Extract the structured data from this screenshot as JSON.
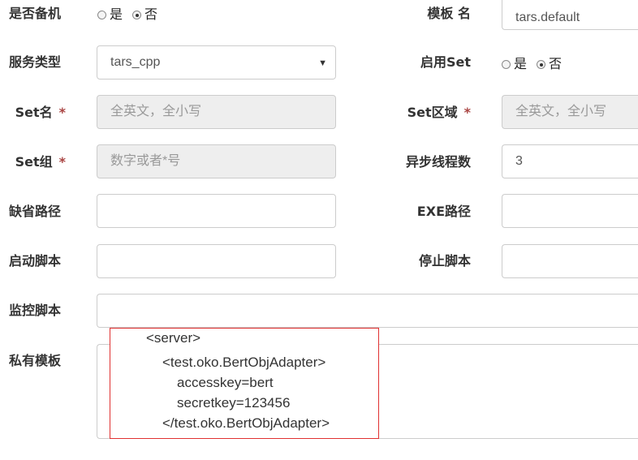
{
  "backup": {
    "label": "是否备机",
    "options": [
      "是",
      "否"
    ],
    "selected": "否"
  },
  "template_name": {
    "label": "模板 名",
    "value": "tars.default"
  },
  "service_type": {
    "label": "服务类型",
    "value": "tars_cpp"
  },
  "enable_set": {
    "label": "启用Set",
    "options": [
      "是",
      "否"
    ],
    "selected": "否"
  },
  "set_name": {
    "label": "Set名",
    "required_mark": "*",
    "placeholder": "全英文，全小写"
  },
  "set_area": {
    "label": "Set区域",
    "required_mark": "*",
    "placeholder": "全英文，全小写"
  },
  "set_group": {
    "label": "Set组",
    "required_mark": "*",
    "placeholder": "数字或者*号"
  },
  "async_threads": {
    "label": "异步线程数",
    "value": "3"
  },
  "default_path": {
    "label": "缺省路径",
    "value": ""
  },
  "exe_path": {
    "label": "EXE路径",
    "value": ""
  },
  "start_script": {
    "label": "启动脚本",
    "value": ""
  },
  "stop_script": {
    "label": "停止脚本",
    "value": ""
  },
  "monitor_script": {
    "label": "监控脚本",
    "value": ""
  },
  "private_template": {
    "label": "私有模板",
    "lines": [
      "<server>",
      "<test.oko.BertObjAdapter>",
      "accesskey=bert",
      "secretkey=123456",
      "</test.oko.BertObjAdapter>"
    ]
  },
  "colors": {
    "required": "#a94442",
    "highlight_border": "#e03131",
    "disabled_bg": "#eeeeee"
  }
}
